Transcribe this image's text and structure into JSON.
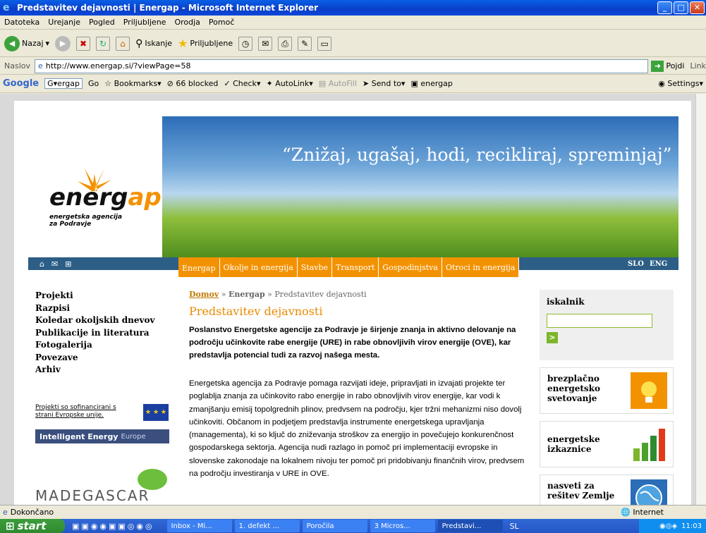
{
  "window": {
    "title": "Predstavitev dejavnosti | Energap - Microsoft Internet Explorer"
  },
  "menu": [
    "Datoteka",
    "Urejanje",
    "Pogled",
    "Priljubljene",
    "Orodja",
    "Pomoč"
  ],
  "toolbar": {
    "back": "Nazaj",
    "search": "Iskanje",
    "favorites": "Priljubljene"
  },
  "address": {
    "label": "Naslov",
    "url": "http://www.energap.si/?viewPage=58",
    "go": "Pojdi",
    "links": "Link"
  },
  "googlebar": {
    "logo": "Google",
    "query": "ergap",
    "go": "Go",
    "bookmarks": "Bookmarks",
    "blocked": "66 blocked",
    "check": "Check",
    "autolink": "AutoLink",
    "autofill": "AutoFill",
    "sendto": "Send to",
    "energap": "energap",
    "settings": "Settings"
  },
  "site": {
    "slogan": "“Znižaj, ugašaj, hodi, recikliraj, spreminjaj”",
    "logo_main": "energ",
    "logo_accent": "ap",
    "logo_sub1": "energetska agencija",
    "logo_sub2": "za Podravje",
    "lang": [
      "SLO",
      "ENG"
    ],
    "tabs": [
      "Energap",
      "Okolje in energija",
      "Stavbe",
      "Transport",
      "Gospodinjstva",
      "Otroci in energija"
    ],
    "leftnav": [
      "Projekti",
      "Razpisi",
      "Koledar okoljskih dnevov",
      "Publikacije in literatura",
      "Fotogalerija",
      "Povezave",
      "Arhiv"
    ],
    "eu_text": "Projekti so sofinancirani s strani Evropske unije.",
    "ie_text": "Intelligent Energy",
    "ie_europe": "Europe",
    "madegascar": "MADEGASCAR",
    "crumb_home": "Domov",
    "crumb_mid": "Energap",
    "crumb_current": "Predstavitev dejavnosti",
    "crumb_sep": "»",
    "heading": "Predstavitev dejavnosti",
    "lead": "Poslanstvo Energetske agencije za Podravje je širjenje znanja in aktivno delovanje na področju učinkovite rabe energije (URE) in rabe obnovljivih virov energije (OVE), kar predstavlja potencial tudi za razvoj našega mesta.",
    "body": "Energetska agencija za Podravje pomaga razvijati ideje, pripravljati in izvajati projekte ter poglablja znanja za učinkovito rabo energije in rabo obnovljivih virov energije, kar vodi k zmanjšanju emisij topolgrednih plinov, predvsem na področju, kjer tržni mehanizmi niso dovolj učinkoviti. Občanom in podjetjem predstavlja instrumente energetskega upravljanja (managementa), ki so ključ do zniževanja stroškov za energijo in povečujejo konkurenčnost gospodarskega sektorja. Agencija nudi razlago in pomoč pri implementaciji evropske in slovenske zakonodaje na lokalnem nivoju ter pomoč pri pridobivanju finančnih virov, predvsem na področju investiranja v URE in OVE.",
    "search_label": "iskalnik",
    "search_go": ">",
    "box1": "brezplačno energetsko svetovanje",
    "box2": "energetske izkaznice",
    "box3": "nasveti za rešitev Zemlje"
  },
  "status": {
    "text": "Dokončano",
    "zone": "Internet"
  },
  "taskbar": {
    "start": "start",
    "tasks": [
      "Inbox - Mi...",
      "1. defekt ...",
      "Poročila",
      "3 Micros...",
      "Predstavi..."
    ],
    "lang": "SL",
    "time": "11:03"
  },
  "colors": {
    "accent": "#F39200",
    "nav": "#2C5E86",
    "xpblue": "#0A5FE6"
  }
}
